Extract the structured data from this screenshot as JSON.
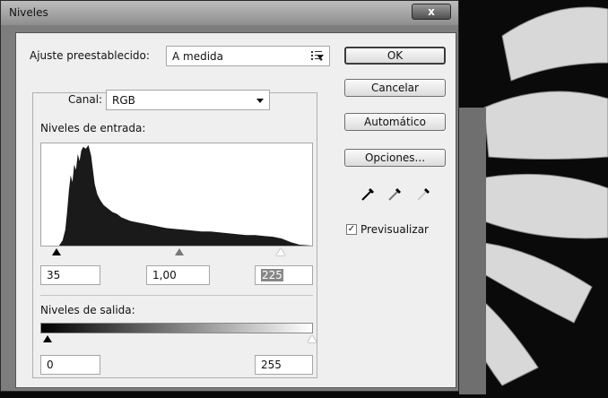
{
  "window": {
    "title": "Niveles",
    "close_glyph": "x"
  },
  "preset": {
    "label": "Ajuste preestablecido:",
    "value": "A medida",
    "menu_icon": "list-menu-icon"
  },
  "channel": {
    "label": "Canal:",
    "value": "RGB"
  },
  "input_levels": {
    "label": "Niveles de entrada:",
    "black": "35",
    "gamma": "1,00",
    "white": "225"
  },
  "output_levels": {
    "label": "Niveles de salida:",
    "black": "0",
    "white": "255"
  },
  "buttons": {
    "ok": "OK",
    "cancel": "Cancelar",
    "auto": "Automático",
    "options": "Opciones..."
  },
  "eyedroppers": [
    "black-point-eyedropper-icon",
    "gray-point-eyedropper-icon",
    "white-point-eyedropper-icon"
  ],
  "preview": {
    "label": "Previsualizar",
    "checked": true,
    "check_glyph": "✓"
  }
}
